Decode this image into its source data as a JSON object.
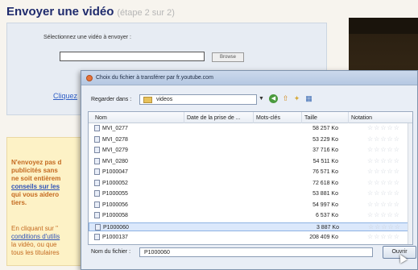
{
  "page": {
    "title": "Envoyer une vidéo",
    "step": "(étape 2 sur 2)",
    "select_label": "Sélectionnez une vidéo à envoyer :",
    "browse_label": "Browse",
    "link_text": "Cliquez"
  },
  "warning": {
    "line1": "N'envoyez pas d",
    "line2": "publicités sans",
    "line3": "ne soit entièrem",
    "line4": "conseils sur les",
    "line5": "qui vous aidero",
    "line6": "tiers.",
    "line7": "En cliquant sur \"",
    "line8": "conditions d'utilis",
    "line9": "la vidéo, ou que",
    "line10": "tous les titulaires"
  },
  "dialog": {
    "title": "Choix du fichier à transférer par fr.youtube.com",
    "look_in_label": "Regarder dans :",
    "look_in_value": "videos",
    "columns": [
      "Nom",
      "Date de la prise de ...",
      "Mots-clés",
      "Taille",
      "Notation"
    ],
    "files": [
      {
        "name": "MVI_0277",
        "size": "58 257 Ko"
      },
      {
        "name": "MVI_0278",
        "size": "53 229 Ko"
      },
      {
        "name": "MVI_0279",
        "size": "37 716 Ko"
      },
      {
        "name": "MVI_0280",
        "size": "54 511 Ko"
      },
      {
        "name": "P1000047",
        "size": "76 571 Ko"
      },
      {
        "name": "P1000052",
        "size": "72 618 Ko"
      },
      {
        "name": "P1000055",
        "size": "53 881 Ko"
      },
      {
        "name": "P1000056",
        "size": "54 997 Ko"
      },
      {
        "name": "P1000058",
        "size": "6 537 Ko"
      },
      {
        "name": "P1000060",
        "size": "3 887 Ko"
      },
      {
        "name": "P1000137",
        "size": "208 409 Ko"
      }
    ],
    "selected_index": 9,
    "rating_stars": "☆☆☆☆☆",
    "filename_label": "Nom du fichier :",
    "filename_value": "P1000060",
    "open_label": "Ouvrir"
  },
  "colors": {
    "title": "#1f2b6d",
    "warning_text": "#c46a20",
    "link": "#2f5ec4",
    "selection": "#dbe8fb"
  },
  "icons": {
    "play": "play-icon",
    "sound": "sound-icon",
    "folder": "folder-icon",
    "file": "video-file-icon",
    "back": "back-icon",
    "up": "up-folder-icon",
    "new_folder": "new-folder-icon",
    "views": "views-icon"
  }
}
